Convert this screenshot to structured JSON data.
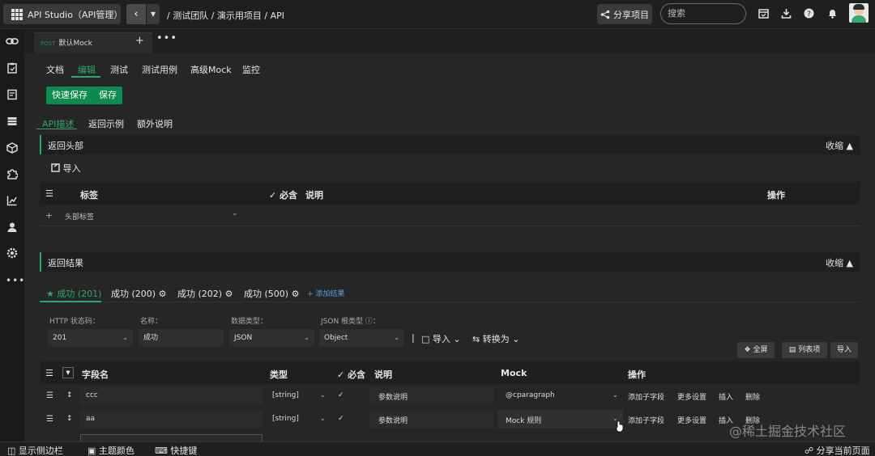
{
  "topbar": {
    "app_label": "API Studio（API管理）",
    "breadcrumb": "/ 测试团队 / 演示用项目 / API",
    "share_label": "分享项目",
    "search_placeholder": "搜索"
  },
  "tabs": {
    "method": "POST",
    "name": "默认Mock",
    "add": "+",
    "more": "•••"
  },
  "subtabs": [
    "文档",
    "编辑",
    "测试",
    "测试用例",
    "高级Mock",
    "监控"
  ],
  "save_buttons": {
    "quick": "快速保存",
    "save": "保存"
  },
  "inner_tabs": [
    "API描述",
    "返回示例",
    "额外说明"
  ],
  "response_headers": {
    "title": "返回头部",
    "collapse": "收缩",
    "import": "导入",
    "columns": {
      "label": "标签",
      "required": "必含",
      "desc": "说明",
      "actions": "操作"
    },
    "row_placeholder": "头部标签"
  },
  "response_results": {
    "title": "返回结果",
    "collapse": "收缩",
    "tabs": [
      "成功 (201)",
      "成功 (200)",
      "成功 (202)",
      "成功 (500)"
    ],
    "add_result": "+ 添加结果",
    "fields": {
      "http_status_label": "HTTP 状态码：",
      "http_status_value": "201",
      "name_label": "名称：",
      "name_value": "成功",
      "data_type_label": "数据类型：",
      "data_type_value": "JSON",
      "json_root_label": "JSON 根类型 ⓘ：",
      "json_root_value": "Object"
    },
    "import": "导入",
    "convert": "转换为",
    "buttons": {
      "fullscreen": "全屏",
      "list_view": "列表项",
      "import": "导入"
    },
    "columns": {
      "field": "字段名",
      "type": "类型",
      "required": "必含",
      "desc": "说明",
      "mock": "Mock",
      "actions": "操作"
    },
    "rows": [
      {
        "field": "ccc",
        "type": "[string]",
        "desc": "参数说明",
        "mock": "@cparagraph",
        "a1": "添加子字段",
        "a2": "更多设置",
        "a3": "插入",
        "a4": "删除"
      },
      {
        "field": "aa",
        "type": "[string]",
        "desc": "参数说明",
        "mock": "Mock 规则",
        "a1": "添加子字段",
        "a2": "更多设置",
        "a3": "插入",
        "a4": "删除"
      }
    ]
  },
  "watermark": "@稀土掘金技术社区",
  "bottombar": {
    "show_sidebar": "显示侧边栏",
    "theme_color": "主题颜色",
    "shortcuts": "快捷键",
    "share_page": "分享当前页面"
  },
  "colors": {
    "accent": "#2ea86a",
    "link": "#5a9fd6",
    "background": "#262626"
  }
}
